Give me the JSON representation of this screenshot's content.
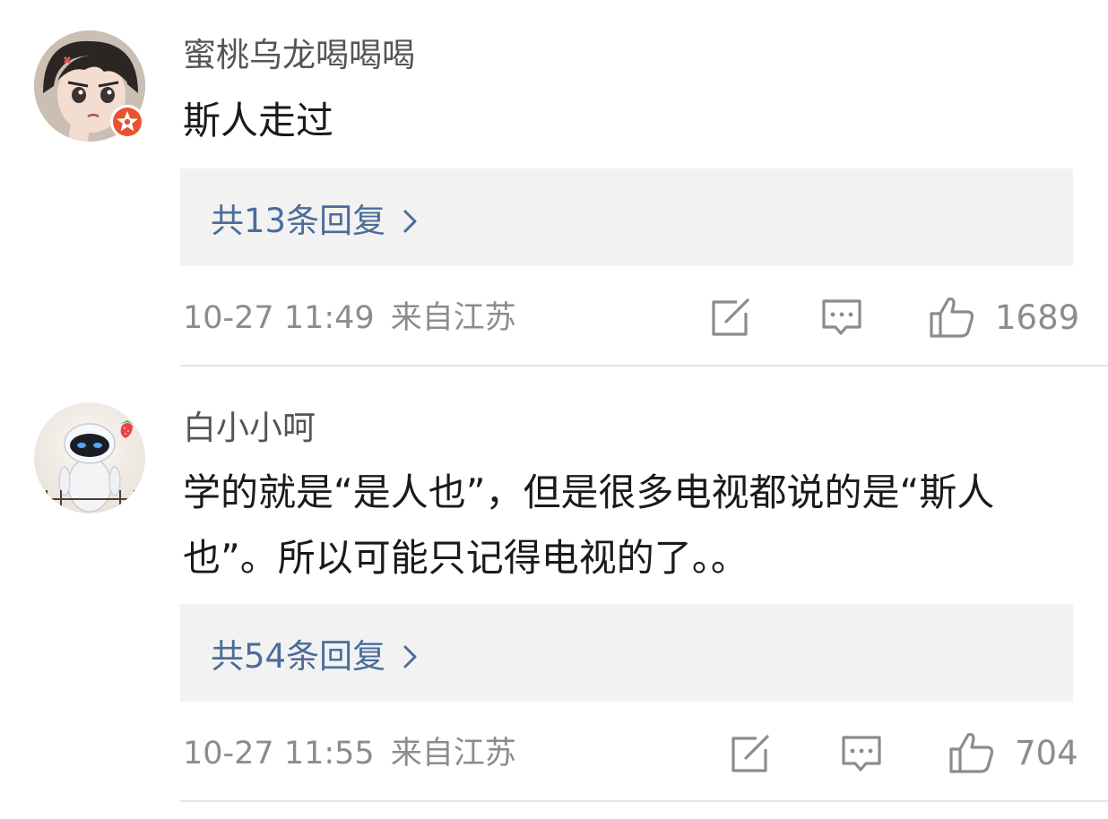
{
  "comments": [
    {
      "username": "蜜桃乌龙喝喝喝",
      "content": "斯人走过",
      "reply_text": "共13条回复",
      "time": "10-27 11:49",
      "location": "来自江苏",
      "likes": "1689",
      "avatar_icon": "anime-character-avatar",
      "badge_icon": "star-badge-icon"
    },
    {
      "username": "白小小呵",
      "content": "学的就是“是人也”，但是很多电视都说的是“斯人也”。所以可能只记得电视的了。。",
      "reply_text": "共54条回复",
      "time": "10-27 11:55",
      "location": "来自江苏",
      "likes": "704",
      "avatar_icon": "robot-eve-avatar"
    }
  ],
  "colors": {
    "link_blue": "#4a6d9a",
    "meta_gray": "#8c8c8c",
    "reply_bg": "#f2f2f2",
    "badge_red": "#e8522f"
  }
}
